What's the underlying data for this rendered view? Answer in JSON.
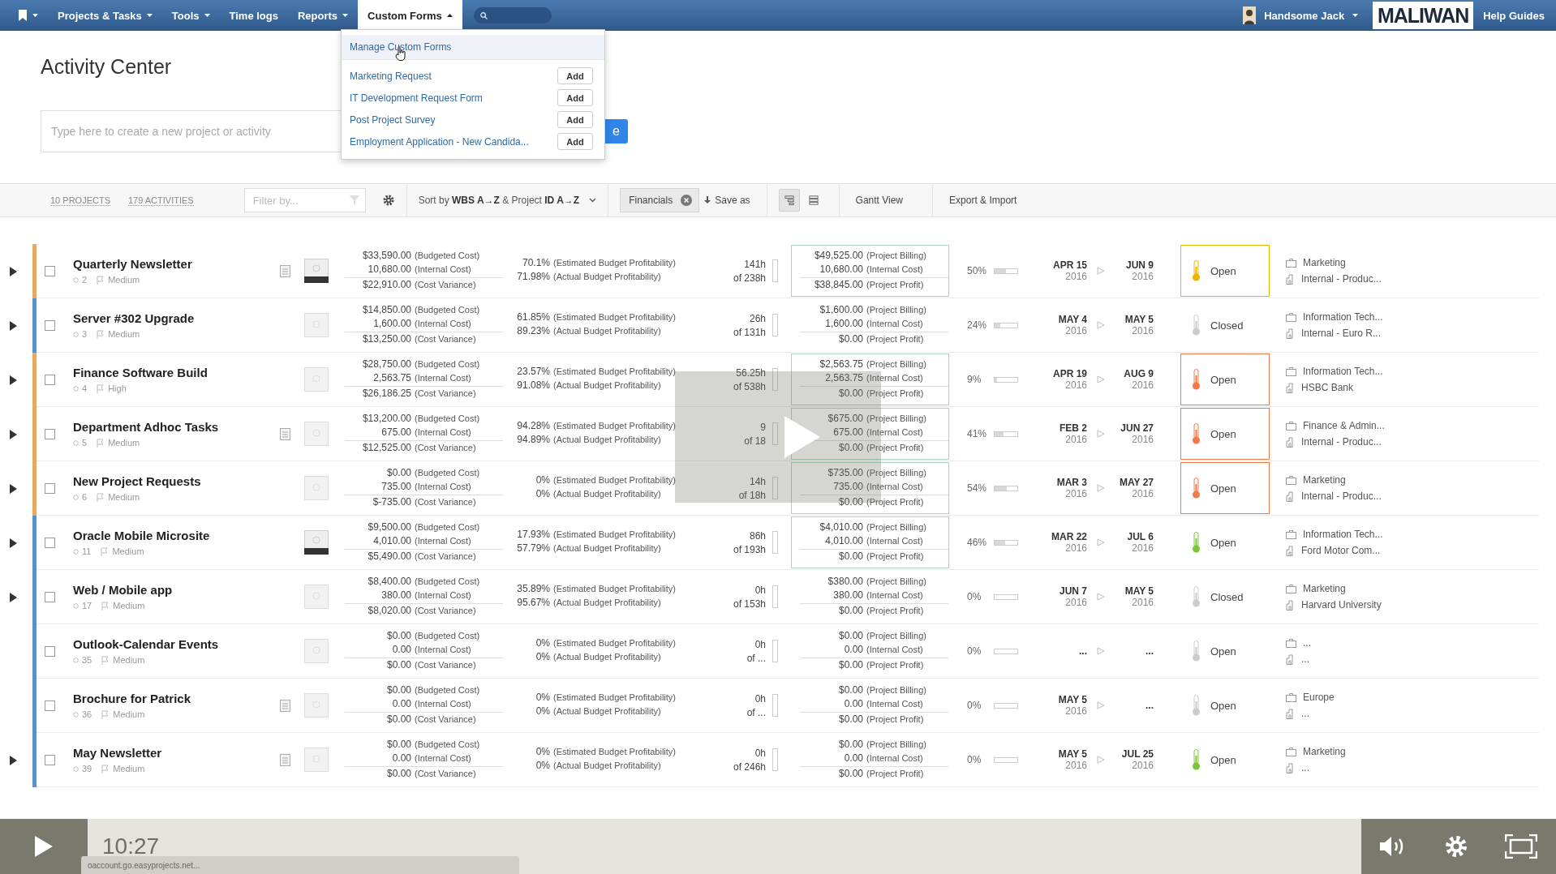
{
  "nav": {
    "items": [
      {
        "label": "Projects & Tasks",
        "caret": true,
        "selected": false
      },
      {
        "label": "Tools",
        "caret": true,
        "selected": false
      },
      {
        "label": "Time logs",
        "caret": false,
        "selected": false
      },
      {
        "label": "Reports",
        "caret": true,
        "selected": false
      },
      {
        "label": "Custom Forms",
        "caret": true,
        "selected": true
      }
    ],
    "user": "Handsome Jack",
    "logo": "MALIWAN",
    "help": "Help Guides"
  },
  "page_title": "Activity Center",
  "create": {
    "placeholder": "Type here to create a new project or activity",
    "button": "e"
  },
  "custom_forms_menu": {
    "items": [
      {
        "label": "Manage Custom Forms",
        "selected": true
      },
      {
        "label": "Marketing Request",
        "button": "Add",
        "selected": false
      },
      {
        "label": "IT Development Request Form",
        "button": "Add",
        "selected": false
      },
      {
        "label": "Post Project Survey",
        "button": "Add",
        "selected": false
      },
      {
        "label": "Employment Application - New Candida...",
        "button": "Add",
        "selected": false
      }
    ]
  },
  "toolbar": {
    "counts": [
      "10 PROJECTS",
      "179 ACTIVITIES"
    ],
    "filter_placeholder": "Filter by...",
    "sort": "Sort by **WBS A→Z** & Project **ID A→Z**",
    "chip": "Financials",
    "save": "Save as",
    "views": [
      {
        "kind": "tree",
        "selected": true
      },
      {
        "kind": "list",
        "selected": false
      }
    ],
    "gantt": "Gantt View",
    "export": "Export & Import"
  },
  "rows": [
    {
      "expandable": true,
      "checked": false,
      "color": "#e8a866",
      "name": "Quarterly Newsletter",
      "id": "2",
      "priority": "Medium",
      "note": true,
      "thumbnail": {
        "kind": "dark"
      },
      "costs": [
        [
          "$33,590.00",
          "(Budgeted Cost)"
        ],
        [
          "10,680.00",
          "(Internal Cost)"
        ],
        [
          "$22,910.00",
          "(Cost Variance)"
        ]
      ],
      "profit": [
        [
          "70.1%",
          "(Estimated Budget Profitability)"
        ],
        [
          "71.98%",
          "(Actual Budget Profitability)"
        ]
      ],
      "hours": [
        "141h",
        "of 238h"
      ],
      "billing": [
        [
          "$49,525.00",
          "(Project Billing)"
        ],
        [
          "10,680.00",
          "(Internal Cost)"
        ],
        [
          "$38,845.00",
          "(Project Profit)"
        ]
      ],
      "billing_outlined": true,
      "percent": "50%",
      "level": 0.5,
      "start": [
        "APR 15",
        "2016"
      ],
      "end": [
        "JUN 9",
        "2016"
      ],
      "status": {
        "text": "Open",
        "color": "#f0b400",
        "outlined": true
      },
      "category": "Marketing",
      "client": "Internal - Produc..."
    },
    {
      "expandable": true,
      "checked": false,
      "color": "#5b8fce",
      "name": "Server #302 Upgrade",
      "id": "3",
      "priority": "Medium",
      "note": false,
      "thumbnail": {
        "kind": "light"
      },
      "costs": [
        [
          "$14,850.00",
          "(Budgeted Cost)"
        ],
        [
          "1,600.00",
          "(Internal Cost)"
        ],
        [
          "$13,250.00",
          "(Cost Variance)"
        ]
      ],
      "profit": [
        [
          "61.85%",
          "(Estimated Budget Profitability)"
        ],
        [
          "89.23%",
          "(Actual Budget Profitability)"
        ]
      ],
      "hours": [
        "26h",
        "of 131h"
      ],
      "billing": [
        [
          "$1,600.00",
          "(Project Billing)"
        ],
        [
          "1,600.00",
          "(Internal Cost)"
        ],
        [
          "$0.00",
          "(Project Profit)"
        ]
      ],
      "billing_outlined": false,
      "percent": "24%",
      "level": 0.24,
      "start": [
        "MAY 4",
        "2016"
      ],
      "end": [
        "MAY 5",
        "2016"
      ],
      "status": {
        "text": "Closed",
        "color": "#cccccc",
        "outlined": false
      },
      "category": "Information Tech...",
      "client": "Internal - Euro R..."
    },
    {
      "expandable": true,
      "checked": false,
      "color": "#e8a866",
      "name": "Finance Software Build",
      "id": "4",
      "priority": "High",
      "note": false,
      "thumbnail": {
        "kind": "light"
      },
      "costs": [
        [
          "$28,750.00",
          "(Budgeted Cost)"
        ],
        [
          "2,563.75",
          "(Internal Cost)"
        ],
        [
          "$26,186.25",
          "(Cost Variance)"
        ]
      ],
      "profit": [
        [
          "23.57%",
          "(Estimated Budget Profitability)"
        ],
        [
          "91.08%",
          "(Actual Budget Profitability)"
        ]
      ],
      "hours": [
        "56.25h",
        "of 538h"
      ],
      "billing": [
        [
          "$2,563.75",
          "(Project Billing)"
        ],
        [
          "2,563.75",
          "(Internal Cost)"
        ],
        [
          "$0.00",
          "(Project Profit)"
        ]
      ],
      "billing_outlined": true,
      "percent": "9%",
      "level": 0.09,
      "start": [
        "APR 19",
        "2016"
      ],
      "end": [
        "AUG 9",
        "2016"
      ],
      "status": {
        "text": "Open",
        "color": "#f07a4a",
        "outlined": true
      },
      "category": "Information Tech...",
      "client": "HSBC Bank"
    },
    {
      "expandable": true,
      "checked": false,
      "color": "#e8a866",
      "name": "Department Adhoc Tasks",
      "id": "5",
      "priority": "Medium",
      "note": true,
      "thumbnail": {
        "kind": "light"
      },
      "costs": [
        [
          "$13,200.00",
          "(Budgeted Cost)"
        ],
        [
          "675.00",
          "(Internal Cost)"
        ],
        [
          "$12,525.00",
          "(Cost Variance)"
        ]
      ],
      "profit": [
        [
          "94.28%",
          "(Estimated Budget Profitability)"
        ],
        [
          "94.89%",
          "(Actual Budget Profitability)"
        ]
      ],
      "hours": [
        "9",
        "of 18"
      ],
      "billing": [
        [
          "$675.00",
          "(Project Billing)"
        ],
        [
          "675.00",
          "(Internal Cost)"
        ],
        [
          "$0.00",
          "(Project Profit)"
        ]
      ],
      "billing_outlined": true,
      "percent": "41%",
      "level": 0.41,
      "start": [
        "FEB 2",
        "2016"
      ],
      "end": [
        "JUN 27",
        "2016"
      ],
      "status": {
        "text": "Open",
        "color": "#f07a4a",
        "outlined": true
      },
      "category": "Finance & Admin...",
      "client": "Internal - Produc..."
    },
    {
      "expandable": true,
      "checked": false,
      "color": "#e8a866",
      "name": "New Project Requests",
      "id": "6",
      "priority": "Medium",
      "note": false,
      "thumbnail": {
        "kind": "light"
      },
      "costs": [
        [
          "$0.00",
          "(Budgeted Cost)"
        ],
        [
          "735.00",
          "(Internal Cost)"
        ],
        [
          "$-735.00",
          "(Cost Variance)"
        ]
      ],
      "profit": [
        [
          "0%",
          "(Estimated Budget Profitability)"
        ],
        [
          "0%",
          "(Actual Budget Profitability)"
        ]
      ],
      "hours": [
        "14h",
        "of 18h"
      ],
      "billing": [
        [
          "$735.00",
          "(Project Billing)"
        ],
        [
          "735.00",
          "(Internal Cost)"
        ],
        [
          "$0.00",
          "(Project Profit)"
        ]
      ],
      "billing_outlined": true,
      "percent": "54%",
      "level": 0.54,
      "start": [
        "MAR 3",
        "2016"
      ],
      "end": [
        "MAY 27",
        "2016"
      ],
      "status": {
        "text": "Open",
        "color": "#f07a4a",
        "outlined": true
      },
      "category": "Marketing",
      "client": "Internal - Produc..."
    },
    {
      "expandable": true,
      "checked": false,
      "color": "#5b8fce",
      "name": "Oracle Mobile Microsite",
      "id": "11",
      "priority": "Medium",
      "note": false,
      "thumbnail": {
        "kind": "dark"
      },
      "costs": [
        [
          "$9,500.00",
          "(Budgeted Cost)"
        ],
        [
          "4,010.00",
          "(Internal Cost)"
        ],
        [
          "$5,490.00",
          "(Cost Variance)"
        ]
      ],
      "profit": [
        [
          "17.93%",
          "(Estimated Budget Profitability)"
        ],
        [
          "57.79%",
          "(Actual Budget Profitability)"
        ]
      ],
      "hours": [
        "86h",
        "of 193h"
      ],
      "billing": [
        [
          "$4,010.00",
          "(Project Billing)"
        ],
        [
          "4,010.00",
          "(Internal Cost)"
        ],
        [
          "$0.00",
          "(Project Profit)"
        ]
      ],
      "billing_outlined": true,
      "percent": "46%",
      "level": 0.46,
      "start": [
        "MAR 22",
        "2016"
      ],
      "end": [
        "JUL 6",
        "2016"
      ],
      "status": {
        "text": "Open",
        "color": "#7cc43c",
        "outlined": false
      },
      "category": "Information Tech...",
      "client": "Ford Motor Com..."
    },
    {
      "expandable": true,
      "checked": false,
      "color": "#5b8fce",
      "name": "Web / Mobile app",
      "id": "17",
      "priority": "Medium",
      "note": false,
      "thumbnail": {
        "kind": "light"
      },
      "costs": [
        [
          "$8,400.00",
          "(Budgeted Cost)"
        ],
        [
          "380.00",
          "(Internal Cost)"
        ],
        [
          "$8,020.00",
          "(Cost Variance)"
        ]
      ],
      "profit": [
        [
          "35.89%",
          "(Estimated Budget Profitability)"
        ],
        [
          "95.67%",
          "(Actual Budget Profitability)"
        ]
      ],
      "hours": [
        "0h",
        "of 153h"
      ],
      "billing": [
        [
          "$380.00",
          "(Project Billing)"
        ],
        [
          "380.00",
          "(Internal Cost)"
        ],
        [
          "$0.00",
          "(Project Profit)"
        ]
      ],
      "billing_outlined": false,
      "percent": "0%",
      "level": 0,
      "start": [
        "JUN 7",
        "2016"
      ],
      "end": [
        "MAY 5",
        "2016"
      ],
      "status": {
        "text": "Closed",
        "color": "#cccccc",
        "outlined": false
      },
      "category": "Marketing",
      "client": "Harvard University"
    },
    {
      "expandable": false,
      "checked": false,
      "color": "#5b8fce",
      "name": "Outlook-Calendar Events",
      "id": "35",
      "priority": "Medium",
      "note": false,
      "thumbnail": {
        "kind": "light"
      },
      "costs": [
        [
          "$0.00",
          "(Budgeted Cost)"
        ],
        [
          "0.00",
          "(Internal Cost)"
        ],
        [
          "$0.00",
          "(Cost Variance)"
        ]
      ],
      "profit": [
        [
          "0%",
          "(Estimated Budget Profitability)"
        ],
        [
          "0%",
          "(Actual Budget Profitability)"
        ]
      ],
      "hours": [
        "0h",
        "of ..."
      ],
      "billing": [
        [
          "$0.00",
          "(Project Billing)"
        ],
        [
          "0.00",
          "(Internal Cost)"
        ],
        [
          "$0.00",
          "(Project Profit)"
        ]
      ],
      "billing_outlined": false,
      "percent": "0%",
      "level": 0,
      "start": [
        "..."
      ],
      "end": [
        "..."
      ],
      "status": {
        "text": "Open",
        "color": "#cccccc",
        "outlined": false
      },
      "category": "...",
      "client": "..."
    },
    {
      "expandable": false,
      "checked": false,
      "color": "#5b8fce",
      "name": "Brochure for Patrick",
      "id": "36",
      "priority": "Medium",
      "note": true,
      "thumbnail": {
        "kind": "light"
      },
      "costs": [
        [
          "$0.00",
          "(Budgeted Cost)"
        ],
        [
          "0.00",
          "(Internal Cost)"
        ],
        [
          "$0.00",
          "(Cost Variance)"
        ]
      ],
      "profit": [
        [
          "0%",
          "(Estimated Budget Profitability)"
        ],
        [
          "0%",
          "(Actual Budget Profitability)"
        ]
      ],
      "hours": [
        "0h",
        "of ..."
      ],
      "billing": [
        [
          "$0.00",
          "(Project Billing)"
        ],
        [
          "0.00",
          "(Internal Cost)"
        ],
        [
          "$0.00",
          "(Project Profit)"
        ]
      ],
      "billing_outlined": false,
      "percent": "0%",
      "level": 0,
      "start": [
        "MAY 5",
        "2016"
      ],
      "end": [
        "..."
      ],
      "status": {
        "text": "Open",
        "color": "#cccccc",
        "outlined": false
      },
      "category": "Europe",
      "client": "..."
    },
    {
      "expandable": true,
      "checked": false,
      "color": "#5b8fce",
      "name": "May Newsletter",
      "id": "39",
      "priority": "Medium",
      "note": true,
      "thumbnail": {
        "kind": "light"
      },
      "costs": [
        [
          "$0.00",
          "(Budgeted Cost)"
        ],
        [
          "0.00",
          "(Internal Cost)"
        ],
        [
          "$0.00",
          "(Cost Variance)"
        ]
      ],
      "profit": [
        [
          "0%",
          "(Estimated Budget Profitability)"
        ],
        [
          "0%",
          "(Actual Budget Profitability)"
        ]
      ],
      "hours": [
        "0h",
        "of 246h"
      ],
      "billing": [
        [
          "$0.00",
          "(Project Billing)"
        ],
        [
          "0.00",
          "(Internal Cost)"
        ],
        [
          "$0.00",
          "(Project Profit)"
        ]
      ],
      "billing_outlined": false,
      "percent": "0%",
      "level": 0,
      "start": [
        "MAY 5",
        "2016"
      ],
      "end": [
        "JUL 25",
        "2016"
      ],
      "status": {
        "text": "Open",
        "color": "#7cc43c",
        "outlined": false
      },
      "category": "Marketing",
      "client": "..."
    }
  ],
  "player": {
    "time": "10:27",
    "url": "oaccount.go.easyprojects.net..."
  }
}
